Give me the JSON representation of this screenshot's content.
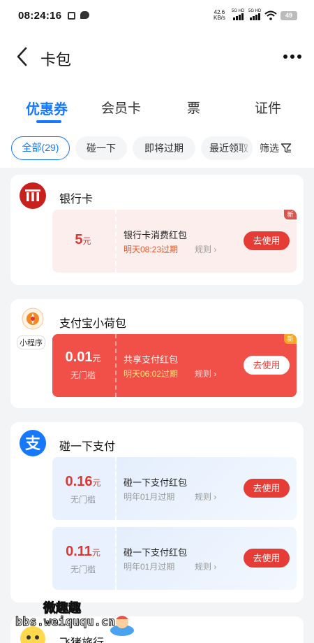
{
  "status_bar": {
    "time": "08:24:16",
    "net_speed_value": "42.6",
    "net_speed_unit": "KB/s",
    "sim1_label": "5G HD",
    "sim2_label": "5G HD",
    "battery": "49"
  },
  "header": {
    "title": "卡包"
  },
  "tabs": [
    {
      "label": "优惠券",
      "active": true
    },
    {
      "label": "会员卡"
    },
    {
      "label": "票"
    },
    {
      "label": "证件"
    }
  ],
  "filters": {
    "chips": [
      {
        "label": "全部(29)",
        "active": true
      },
      {
        "label": "碰一下"
      },
      {
        "label": "即将过期"
      },
      {
        "label": "最近领取"
      }
    ],
    "screen_label": "筛选"
  },
  "groups": [
    {
      "title": "银行卡",
      "icon": "bank-icon",
      "coupons": [
        {
          "amount": "5",
          "unit": "元",
          "threshold": "",
          "name": "银行卡消费红包",
          "expiry": "明天08:23过期",
          "rule": "规则",
          "button": "去使用",
          "new_badge": "新"
        }
      ]
    },
    {
      "title": "支付宝小荷包",
      "icon": "lotus-wallet-icon",
      "logo_tag": "小程序",
      "coupons": [
        {
          "amount": "0.01",
          "unit": "元",
          "threshold": "无门槛",
          "name": "共享支付红包",
          "expiry": "明天06:02过期",
          "rule": "规则",
          "button": "去使用",
          "new_badge": "新"
        }
      ]
    },
    {
      "title": "碰一下支付",
      "icon": "alipay-icon",
      "coupons": [
        {
          "amount": "0.16",
          "unit": "元",
          "threshold": "无门槛",
          "name": "碰一下支付红包",
          "expiry": "明年01月过期",
          "rule": "规则",
          "button": "去使用"
        },
        {
          "amount": "0.11",
          "unit": "元",
          "threshold": "无门槛",
          "name": "碰一下支付红包",
          "expiry": "明年01月过期",
          "rule": "规则",
          "button": "去使用"
        }
      ]
    },
    {
      "title": "飞猪旅行",
      "icon": "fliggy-icon"
    }
  ],
  "watermark": {
    "line1": "微趣趣",
    "line2": "bbs.weiququ.cn"
  },
  "colors": {
    "accent": "#1677ff",
    "bank_red": "#c8201d",
    "coupon_red": "#f05048",
    "button_red": "#e63c36",
    "light_pink": "#fdeeee",
    "light_blue": "#e8f1fd",
    "expiry_orange": "#f08a24"
  }
}
